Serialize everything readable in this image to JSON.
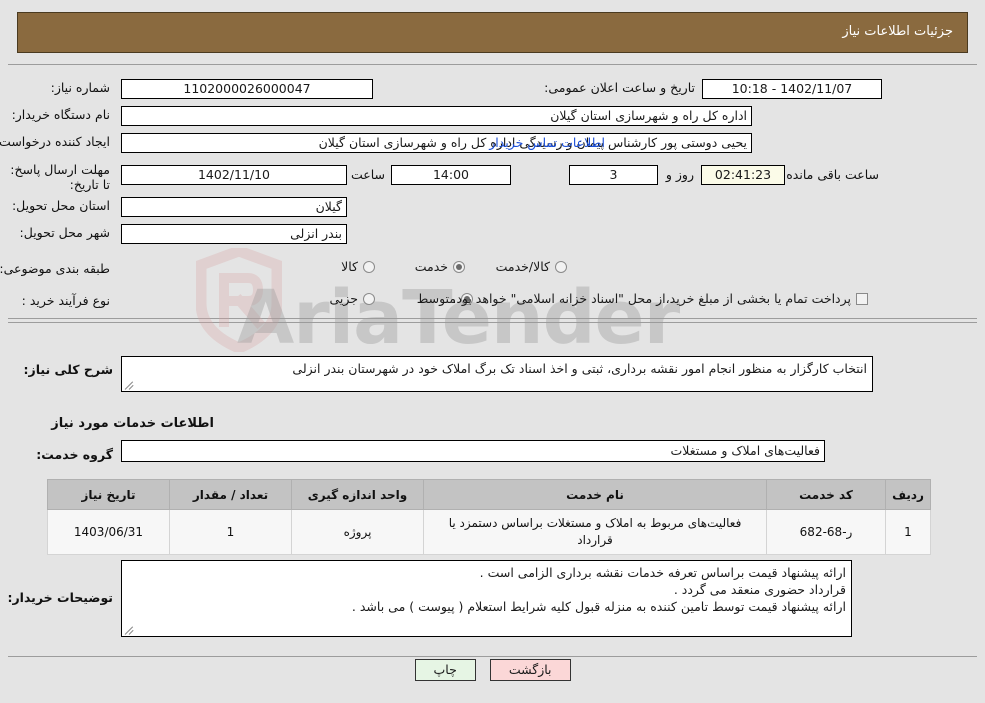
{
  "header": {
    "title": "جزئیات اطلاعات نیاز"
  },
  "watermark": {
    "text": "AriaTender",
    "logo_color": "#d9a3a3"
  },
  "fields": {
    "need_number": {
      "label": "شماره نیاز:",
      "value": "1102000026000047"
    },
    "announce_datetime": {
      "label": "تاریخ و ساعت اعلان عمومی:",
      "value": "1402/11/07 - 10:18"
    },
    "buyer_org": {
      "label": "نام دستگاه خریدار:",
      "value": "اداره کل راه و شهرسازی استان گیلان"
    },
    "requester": {
      "label": "ایجاد کننده درخواست:",
      "value": "یحیی دوستی پور کارشناس پیمان و رسیدگی اداره کل راه و شهرسازی استان گیلان",
      "contact_link": "اطلاعات تماس خریدار"
    },
    "deadline": {
      "label": "مهلت ارسال پاسخ: تا تاریخ:",
      "date": "1402/11/10",
      "hour_label": "ساعت",
      "hour": "14:00",
      "days": "3",
      "days_label": "روز و",
      "countdown": "02:41:23",
      "remaining_label": "ساعت باقی مانده"
    },
    "province": {
      "label": "استان محل تحویل:",
      "value": "گیلان"
    },
    "city": {
      "label": "شهر محل تحویل:",
      "value": "بندر انزلی"
    },
    "classification": {
      "label": "طبقه بندی موضوعی:",
      "options": [
        {
          "label": "کالا",
          "selected": false
        },
        {
          "label": "خدمت",
          "selected": true
        },
        {
          "label": "کالا/خدمت",
          "selected": false
        }
      ]
    },
    "purchase_type": {
      "label": "نوع فرآیند خرید :",
      "options": [
        {
          "label": "جزیی",
          "selected": false
        },
        {
          "label": "متوسط",
          "selected": true
        }
      ],
      "treasury_checkbox_label": "پرداخت تمام یا بخشی از مبلغ خرید،از محل \"اسناد خزانه اسلامی\" خواهد بود.",
      "treasury_checked": false
    },
    "general_description": {
      "label": "شرح کلی نیاز:",
      "value": "انتخاب کارگزار به منظور انجام امور نقشه برداری، ثبتی و اخذ اسناد تک برگ املاک خود در شهرستان بندر انزلی"
    },
    "services_heading": "اطلاعات خدمات مورد نیاز",
    "service_group": {
      "label": "گروه خدمت:",
      "value": "فعالیت‌های  املاک و مستغلات"
    },
    "buyer_notes": {
      "label": "توضیحات خریدار:",
      "lines": [
        "ارائه پیشنهاد قیمت براساس تعرفه خدمات نقشه برداری الزامی است .",
        "قرارداد حضوری منعقد می گردد .",
        "ارائه پیشنهاد قیمت توسط تامین کننده به منزله قبول کلیه شرایط استعلام ( پیوست ) می باشد ."
      ]
    }
  },
  "table": {
    "columns": [
      "ردیف",
      "کد خدمت",
      "نام خدمت",
      "واحد اندازه گیری",
      "تعداد / مقدار",
      "تاریخ نیاز"
    ],
    "rows": [
      {
        "row_no": "1",
        "service_code": "ر-68-682",
        "service_name": "فعالیت‌های مربوط به املاک و مستغلات براساس دستمزد یا قرارداد",
        "unit": "پروژه",
        "quantity": "1",
        "need_date": "1403/06/31"
      }
    ]
  },
  "footer": {
    "print_label": "چاپ",
    "back_label": "بازگشت"
  }
}
